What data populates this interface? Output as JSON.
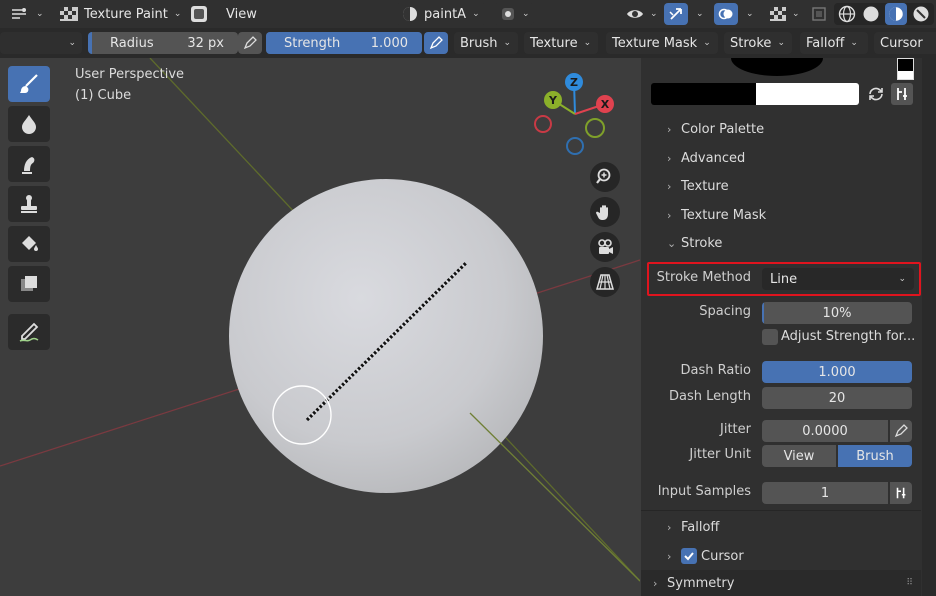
{
  "header": {
    "mode_label": "Texture Paint",
    "view_label": "View",
    "slot_label": "paintA"
  },
  "toolsettings": {
    "radius_label": "Radius",
    "radius_value": "32 px",
    "strength_label": "Strength",
    "strength_value": "1.000",
    "strength_fraction": 1.0,
    "menus": [
      "Brush",
      "Texture",
      "Texture Mask",
      "Stroke",
      "Falloff",
      "Cursor"
    ]
  },
  "viewport": {
    "perspective_label": "User Perspective",
    "object_label": "(1) Cube",
    "gizmo": {
      "z": "Z",
      "y": "Y",
      "x": "X"
    }
  },
  "panel": {
    "sections": {
      "color_palette": "Color Palette",
      "advanced": "Advanced",
      "texture": "Texture",
      "texture_mask": "Texture Mask",
      "stroke": "Stroke",
      "falloff": "Falloff",
      "cursor": "Cursor",
      "symmetry": "Symmetry"
    },
    "stroke_method_label": "Stroke Method",
    "stroke_method_value": "Line",
    "spacing_label": "Spacing",
    "spacing_value": "10%",
    "spacing_fraction": 0.1,
    "adjust_strength_label": "Adjust Strength for...",
    "dash_ratio_label": "Dash Ratio",
    "dash_ratio_value": "1.000",
    "dash_length_label": "Dash Length",
    "dash_length_value": "20",
    "jitter_label": "Jitter",
    "jitter_value": "0.0000",
    "jitter_unit_label": "Jitter Unit",
    "jitter_unit_options": [
      "View",
      "Brush"
    ],
    "jitter_unit_selected": "Brush",
    "input_samples_label": "Input Samples",
    "input_samples_value": "1",
    "cursor_checked": true
  },
  "colors": {
    "accent_blue": "#4772b3",
    "highlight_red": "#e0141e",
    "axis_x": "#e0424f",
    "axis_y": "#8bb02a",
    "axis_z": "#2f8bdc"
  }
}
